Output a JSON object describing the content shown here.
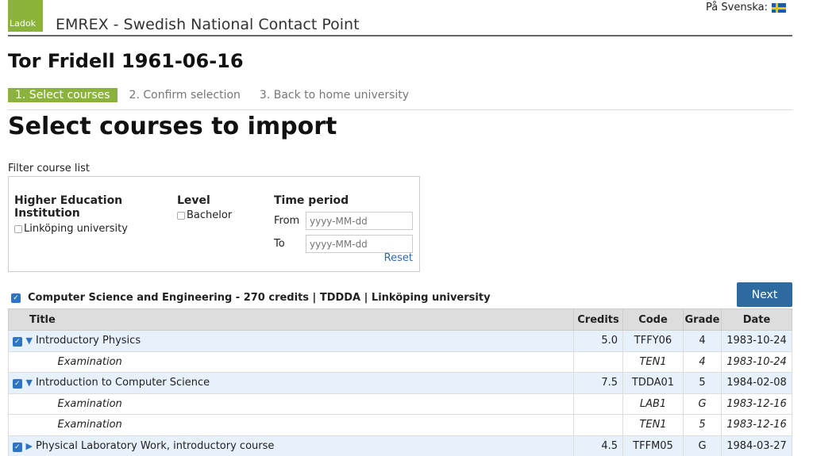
{
  "header": {
    "logo_text": "Ladok",
    "title": "EMREX - Swedish National Contact Point",
    "language_link": "På Svenska:"
  },
  "person": {
    "name_dob": "Tor Fridell 1961-06-16"
  },
  "steps": [
    {
      "label": "1. Select courses",
      "active": true
    },
    {
      "label": "2. Confirm selection",
      "active": false
    },
    {
      "label": "3. Back to home university",
      "active": false
    }
  ],
  "page_heading": "Select courses to import",
  "filter": {
    "label": "Filter course list",
    "institution_heading": "Higher Education Institution",
    "institution_option": "Linköping university",
    "level_heading": "Level",
    "level_option": "Bachelor",
    "time_heading": "Time period",
    "from_label": "From",
    "to_label": "To",
    "from_placeholder": "yyyy-MM-dd",
    "to_placeholder": "yyyy-MM-dd",
    "reset_label": "Reset"
  },
  "program": {
    "label": "Computer Science and Engineering - 270 credits | TDDDA | Linköping university",
    "checked": true
  },
  "next_button": "Next",
  "table": {
    "headers": {
      "title": "Title",
      "credits": "Credits",
      "code": "Code",
      "grade": "Grade",
      "date": "Date"
    },
    "rows": [
      {
        "title": "Introductory Physics",
        "credits": "5.0",
        "code": "TFFY06",
        "grade": "4",
        "date": "1983-10-24"
      },
      {
        "title": "Examination",
        "credits": "",
        "code": "TEN1",
        "grade": "4",
        "date": "1983-10-24"
      },
      {
        "title": "Introduction to Computer Science",
        "credits": "7.5",
        "code": "TDDA01",
        "grade": "5",
        "date": "1984-02-08"
      },
      {
        "title": "Examination",
        "credits": "",
        "code": "LAB1",
        "grade": "G",
        "date": "1983-12-16"
      },
      {
        "title": "Examination",
        "credits": "",
        "code": "TEN1",
        "grade": "5",
        "date": "1983-12-16"
      },
      {
        "title": "Physical Laboratory Work, introductory course",
        "credits": "4.5",
        "code": "TFFM05",
        "grade": "G",
        "date": "1984-03-27"
      }
    ]
  },
  "colors": {
    "accent_green": "#8bb33c",
    "button_blue": "#2c6aa0",
    "course_row_bg": "#e6f1fb"
  }
}
